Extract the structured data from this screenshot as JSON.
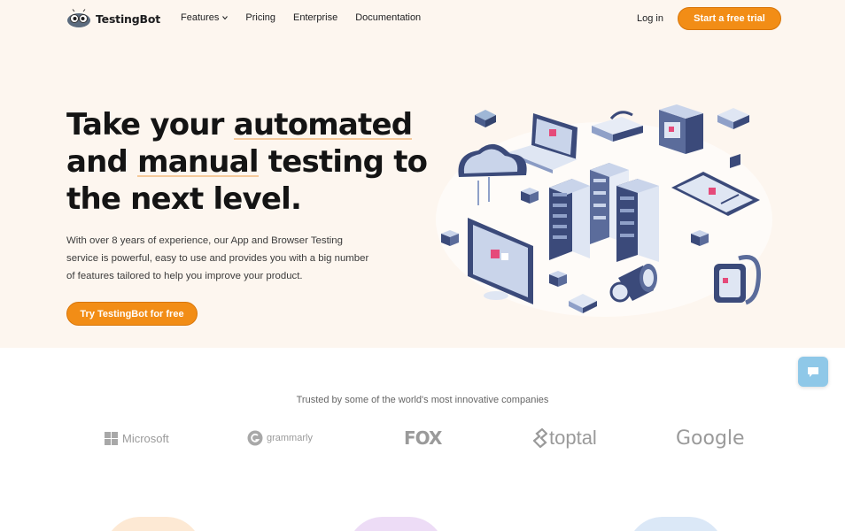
{
  "header": {
    "logo_text": "TestingBot",
    "nav": [
      {
        "label": "Features",
        "has_dropdown": true
      },
      {
        "label": "Pricing"
      },
      {
        "label": "Enterprise"
      },
      {
        "label": "Documentation"
      }
    ],
    "login_label": "Log in",
    "trial_label": "Start a free trial"
  },
  "hero": {
    "headline_parts": [
      "Take your ",
      "automated",
      " and ",
      "manual",
      " testing to the next level."
    ],
    "description": "With over 8 years of experience, our App and Browser Testing service is powerful, easy to use and provides you with a big number of features tailored to help you improve your product.",
    "cta_label": "Try TestingBot for free"
  },
  "trusted": {
    "heading": "Trusted by some of the world's most innovative companies",
    "brands": [
      "Microsoft",
      "grammarly",
      "FOX",
      "toptal",
      "Google"
    ]
  },
  "colors": {
    "accent": "#f28d16",
    "hero_bg": "#fdf6ef",
    "illus_navy": "#3b4a7a",
    "chat": "#8fc8e8"
  },
  "icons": [
    "testingbot-logo-icon",
    "chevron-down-icon",
    "chat-icon",
    "microsoft-icon",
    "grammarly-icon",
    "toptal-icon"
  ]
}
